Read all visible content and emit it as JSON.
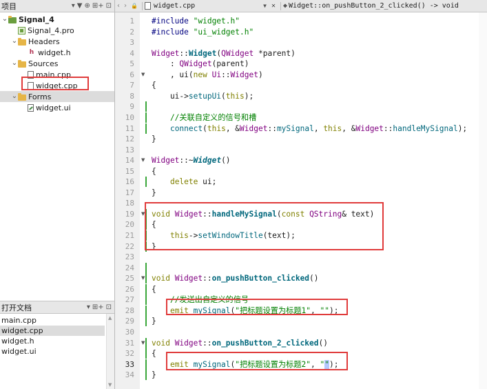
{
  "left_panel": {
    "header": "项目",
    "tools": [
      "▾",
      "▼",
      "⊕",
      "⊞+",
      "⊡"
    ],
    "tree": [
      {
        "label": "Signal_4",
        "level": 0,
        "icon": "project-folder-icon",
        "expanded": true,
        "bold": true
      },
      {
        "label": "Signal_4.pro",
        "level": 1,
        "icon": "pro-file-icon"
      },
      {
        "label": "Headers",
        "level": 1,
        "icon": "headers-folder-icon",
        "expanded": true
      },
      {
        "label": "widget.h",
        "level": 2,
        "icon": "header-file-icon"
      },
      {
        "label": "Sources",
        "level": 1,
        "icon": "sources-folder-icon",
        "expanded": true
      },
      {
        "label": "main.cpp",
        "level": 2,
        "icon": "cpp-file-icon"
      },
      {
        "label": "widget.cpp",
        "level": 2,
        "icon": "cpp-file-icon",
        "selected": true
      },
      {
        "label": "Forms",
        "level": 1,
        "icon": "forms-folder-icon",
        "expanded": true
      },
      {
        "label": "widget.ui",
        "level": 2,
        "icon": "ui-file-icon"
      }
    ]
  },
  "open_docs": {
    "header": "打开文档",
    "tools": [
      "▾",
      "⊞+",
      "⊡"
    ],
    "items": [
      "main.cpp",
      "widget.cpp",
      "widget.h",
      "widget.ui"
    ],
    "active": "widget.cpp"
  },
  "toolbar": {
    "back": "‹",
    "forward": "›",
    "lock": "🔒",
    "file": "widget.cpp",
    "close": "✕",
    "function": "Widget::on_pushButton_2_clicked() -> void"
  },
  "editor": {
    "current_line": 33,
    "lines": [
      [
        [
          "#include ",
          "pp"
        ],
        [
          "\"widget.h\"",
          "str"
        ]
      ],
      [
        [
          "#include ",
          "pp"
        ],
        [
          "\"ui_widget.h\"",
          "str"
        ]
      ],
      [],
      [
        [
          "Widget",
          "ty"
        ],
        [
          "::",
          ""
        ],
        [
          "Widget",
          "fnb"
        ],
        [
          "(",
          ""
        ],
        [
          "QWidget",
          "ty"
        ],
        [
          " *parent)",
          ""
        ]
      ],
      [
        [
          "    : ",
          ""
        ],
        [
          "QWidget",
          "ty"
        ],
        [
          "(parent)",
          ""
        ]
      ],
      [
        [
          "    , ui(",
          ""
        ],
        [
          "new ",
          "kw"
        ],
        [
          "Ui",
          "ty"
        ],
        [
          "::",
          ""
        ],
        [
          "Widget",
          "ty"
        ],
        [
          ")",
          ""
        ]
      ],
      [
        [
          "{",
          ""
        ]
      ],
      [
        [
          "    ui->",
          ""
        ],
        [
          "setupUi",
          "fn"
        ],
        [
          "(",
          ""
        ],
        [
          "this",
          "kw"
        ],
        [
          ");",
          ""
        ]
      ],
      [],
      [
        [
          "    //关联自定义的信号和槽",
          "cm"
        ]
      ],
      [
        [
          "    ",
          ""
        ],
        [
          "connect",
          "fn"
        ],
        [
          "(",
          ""
        ],
        [
          "this",
          "kw"
        ],
        [
          ", &",
          ""
        ],
        [
          "Widget",
          "ty"
        ],
        [
          "::",
          ""
        ],
        [
          "mySignal",
          "fn"
        ],
        [
          ", ",
          ""
        ],
        [
          "this",
          "kw"
        ],
        [
          ", &",
          ""
        ],
        [
          "Widget",
          "ty"
        ],
        [
          "::",
          ""
        ],
        [
          "handleMySignal",
          "fn"
        ],
        [
          ");",
          ""
        ]
      ],
      [
        [
          "}",
          ""
        ]
      ],
      [],
      [
        [
          "Widget",
          "ty"
        ],
        [
          "::~",
          ""
        ],
        [
          "Widget",
          "bi"
        ],
        [
          "()",
          ""
        ]
      ],
      [
        [
          "{",
          ""
        ]
      ],
      [
        [
          "    ",
          ""
        ],
        [
          "delete ",
          "kw"
        ],
        [
          "ui;",
          ""
        ]
      ],
      [
        [
          "}",
          ""
        ]
      ],
      [],
      [
        [
          "void ",
          "kw"
        ],
        [
          "Widget",
          "ty"
        ],
        [
          "::",
          ""
        ],
        [
          "handleMySignal",
          "fnb"
        ],
        [
          "(",
          ""
        ],
        [
          "const ",
          "kw"
        ],
        [
          "QString",
          "ty"
        ],
        [
          "& text)",
          ""
        ]
      ],
      [
        [
          "{",
          ""
        ]
      ],
      [
        [
          "    ",
          ""
        ],
        [
          "this",
          "kw"
        ],
        [
          "->",
          ""
        ],
        [
          "setWindowTitle",
          "fn"
        ],
        [
          "(text);",
          ""
        ]
      ],
      [
        [
          "}",
          ""
        ]
      ],
      [],
      [],
      [
        [
          "void ",
          "kw"
        ],
        [
          "Widget",
          "ty"
        ],
        [
          "::",
          ""
        ],
        [
          "on_pushButton_clicked",
          "fnb"
        ],
        [
          "()",
          ""
        ]
      ],
      [
        [
          "{",
          ""
        ]
      ],
      [
        [
          "    //发送出自定义的信号",
          "cm"
        ]
      ],
      [
        [
          "    ",
          ""
        ],
        [
          "emit ",
          "kw"
        ],
        [
          "mySignal",
          "fn"
        ],
        [
          "(",
          ""
        ],
        [
          "\"把标题设置为标题1\"",
          "str"
        ],
        [
          ", ",
          ""
        ],
        [
          "\"\"",
          "str"
        ],
        [
          ");",
          ""
        ]
      ],
      [
        [
          "}",
          ""
        ]
      ],
      [],
      [
        [
          "void ",
          "kw"
        ],
        [
          "Widget",
          "ty"
        ],
        [
          "::",
          ""
        ],
        [
          "on_pushButton_2_clicked",
          "fnb"
        ],
        [
          "()",
          ""
        ]
      ],
      [
        [
          "{",
          ""
        ]
      ],
      [
        [
          "    ",
          ""
        ],
        [
          "emit ",
          "kw"
        ],
        [
          "mySignal",
          "fn"
        ],
        [
          "(",
          ""
        ],
        [
          "\"把标题设置为标题2\"",
          "str"
        ],
        [
          ", ",
          ""
        ],
        [
          "\"",
          "str"
        ],
        [
          "\"",
          "str caretSel"
        ],
        [
          ");",
          ""
        ]
      ],
      [
        [
          "}",
          ""
        ]
      ]
    ],
    "fold_lines": [
      6,
      14,
      19,
      25,
      31
    ],
    "changed_lines": [
      9,
      10,
      11,
      16,
      19,
      20,
      21,
      22,
      24,
      25,
      26,
      27,
      28,
      29,
      31,
      32,
      33,
      34
    ]
  }
}
